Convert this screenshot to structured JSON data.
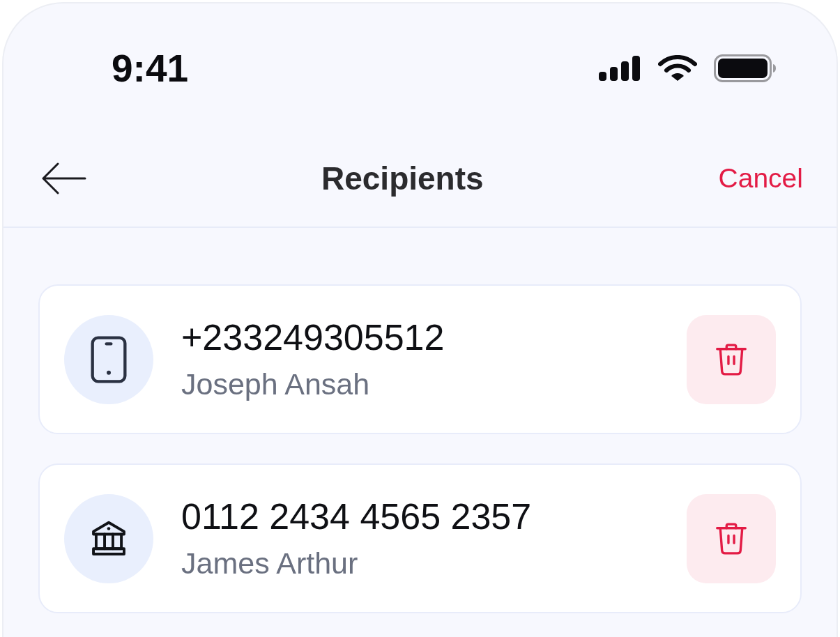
{
  "status_bar": {
    "time": "9:41"
  },
  "header": {
    "title": "Recipients",
    "action": "Cancel"
  },
  "recipients": [
    {
      "kind": "phone",
      "account": "+233249305512",
      "name": "Joseph Ansah"
    },
    {
      "kind": "bank",
      "account": "0112 2434 4565 2357",
      "name": "James Arthur"
    }
  ]
}
